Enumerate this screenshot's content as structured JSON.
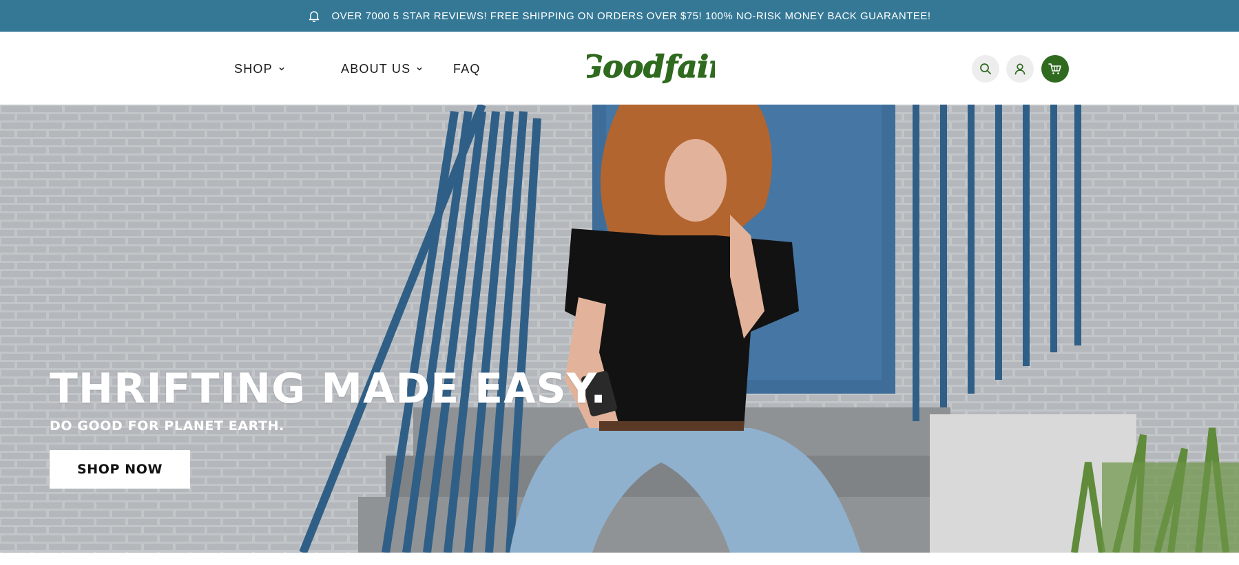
{
  "announcement": {
    "text": "OVER 7000 5 STAR REVIEWS! FREE SHIPPING ON ORDERS OVER $75! 100% NO-RISK MONEY BACK GUARANTEE!",
    "icon": "bell-icon"
  },
  "nav": {
    "shop": "SHOP",
    "about": "ABOUT US",
    "faq": "FAQ"
  },
  "logo": {
    "text": "Goodfair",
    "color": "#2f6a1f"
  },
  "header_icons": {
    "search": "search-icon",
    "account": "user-icon",
    "cart": "cart-icon"
  },
  "hero": {
    "title": "THRIFTING MADE EASY.",
    "subtitle": "DO GOOD FOR PLANET EARTH.",
    "cta": "SHOP NOW"
  },
  "colors": {
    "announcement_bg": "#347896",
    "brand_green": "#2f6a1f",
    "icon_bg": "#ededed"
  }
}
